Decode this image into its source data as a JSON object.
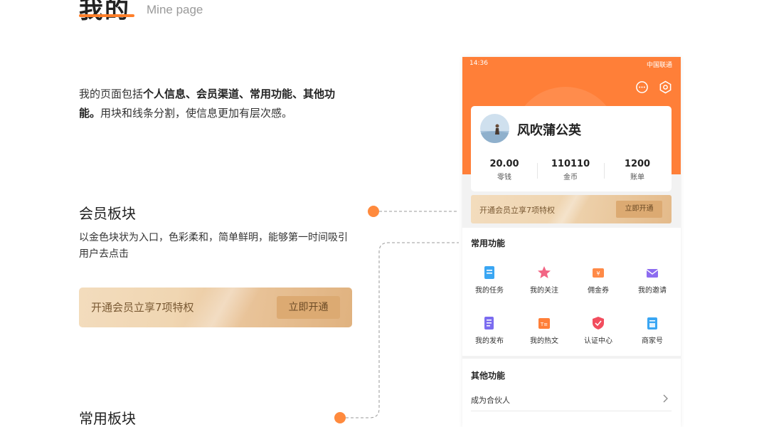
{
  "header": {
    "title": "我的",
    "subtitle": "Mine page"
  },
  "intro": {
    "parts": [
      "我的页面包括",
      "个人信息、会员渠道、常用功能、其他功能。",
      "用块和线条分割，使信息更加有层次感。"
    ]
  },
  "section_member": {
    "title": "会员板块",
    "desc": "以金色块状为入口，色彩柔和，简单鲜明，能够第一时间吸引用户去点击",
    "banner_text": "开通会员立享7项特权",
    "banner_button": "立即开通"
  },
  "section_common": {
    "title": "常用板块"
  },
  "phone": {
    "status_time": "14:36",
    "carrier": "中国联通",
    "icons": [
      "message-icon",
      "settings-icon"
    ],
    "profile": {
      "name": "风吹蒲公英",
      "stats": [
        {
          "value": "20.00",
          "label": "零钱"
        },
        {
          "value": "110110",
          "label": "金币"
        },
        {
          "value": "1200",
          "label": "账单"
        }
      ]
    },
    "vip": {
      "text": "开通会员立享7项特权",
      "button": "立即开通"
    },
    "common": {
      "title": "常用功能",
      "items": [
        {
          "label": "我的任务",
          "icon": "task-icon",
          "color": "#3aa6f3"
        },
        {
          "label": "我的关注",
          "icon": "star-icon",
          "color": "#f26584"
        },
        {
          "label": "佣金券",
          "icon": "coupon-icon",
          "color": "#ff8a47"
        },
        {
          "label": "我的邀请",
          "icon": "mail-icon",
          "color": "#8d6cf0"
        },
        {
          "label": "我的发布",
          "icon": "publish-icon",
          "color": "#7b6cf0"
        },
        {
          "label": "我的热文",
          "icon": "article-icon",
          "color": "#ff7f38"
        },
        {
          "label": "认证中心",
          "icon": "shield-icon",
          "color": "#f24d5e"
        },
        {
          "label": "商家号",
          "icon": "store-icon",
          "color": "#3aa6f3"
        }
      ]
    },
    "other": {
      "title": "其他功能",
      "rows": [
        {
          "label": "成为合伙人"
        }
      ]
    }
  },
  "colors": {
    "accent": "#ff7f38",
    "gold": "#dcaa72",
    "dot": "#ff8a3d"
  }
}
